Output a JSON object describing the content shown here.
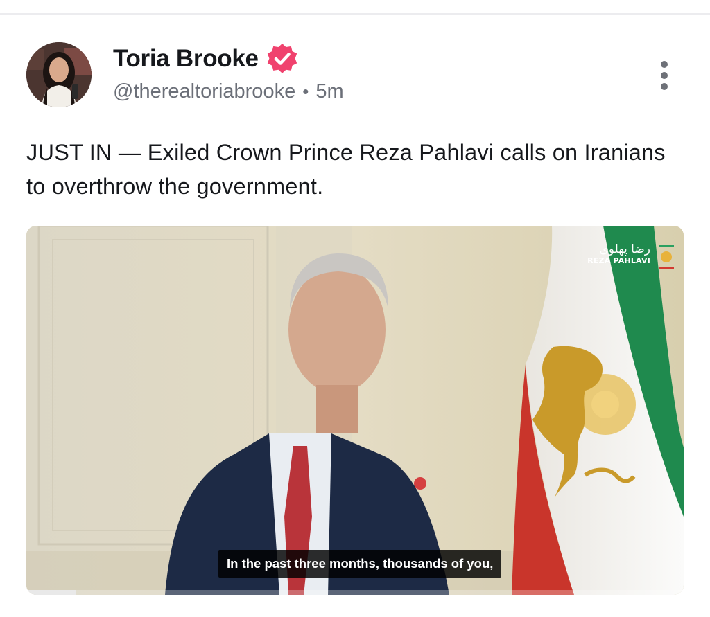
{
  "post": {
    "author": {
      "display_name": "Toria Brooke",
      "handle": "@therealtoriabrooke",
      "verified": true,
      "verified_color": "#f0426e"
    },
    "separator": "•",
    "timestamp": "5m",
    "more_icon": "more-vertical-icon",
    "text": "JUST IN — Exiled Crown Prince Reza Pahlavi calls on Iranians to overthrow the government.",
    "media": {
      "type": "video",
      "watermark_fa": "رضا پهلوی",
      "watermark_en": "REZA PAHLAVI",
      "caption": "In the past three months, thousands of you,",
      "progress": 0.075
    }
  },
  "colors": {
    "text_primary": "#16181c",
    "text_secondary": "#6b6f78",
    "badge": "#f0426e"
  }
}
